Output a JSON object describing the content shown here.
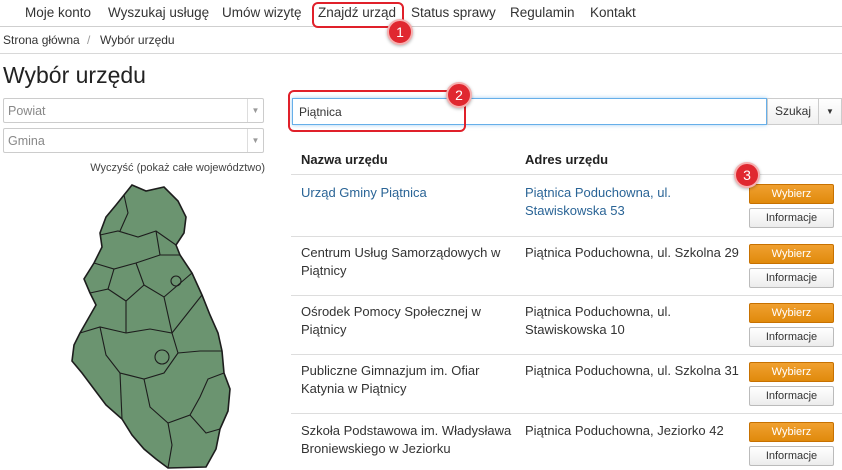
{
  "nav": {
    "items": [
      {
        "label": "Moje konto"
      },
      {
        "label": "Wyszukaj usługę"
      },
      {
        "label": "Umów wizytę"
      },
      {
        "label": "Znajdź urząd"
      },
      {
        "label": "Status sprawy"
      },
      {
        "label": "Regulamin"
      },
      {
        "label": "Kontakt"
      }
    ]
  },
  "breadcrumb": {
    "home": "Strona główna",
    "sep": "/",
    "current": "Wybór urzędu"
  },
  "page": {
    "title": "Wybór urzędu"
  },
  "filters": {
    "powiat": "Powiat",
    "gmina": "Gmina",
    "clear": "Wyczyść (pokaż całe województwo)"
  },
  "search": {
    "value": "Piątnica",
    "button": "Szukaj"
  },
  "table": {
    "headers": {
      "name": "Nazwa urzędu",
      "address": "Adres urzędu"
    },
    "select_label": "Wybierz",
    "info_label": "Informacje",
    "rows": [
      {
        "name": "Urząd Gminy Piątnica",
        "address": "Piątnica Poduchowna, ul. Stawiskowska 53"
      },
      {
        "name": "Centrum Usług Samorządowych w Piątnicy",
        "address": "Piątnica Poduchowna, ul. Szkolna 29"
      },
      {
        "name": "Ośrodek Pomocy Społecznej w Piątnicy",
        "address": "Piątnica Poduchowna, ul. Stawiskowska 10"
      },
      {
        "name": "Publiczne Gimnazjum im. Ofiar Katynia w Piątnicy",
        "address": "Piątnica Poduchowna, ul. Szkolna 31"
      },
      {
        "name": "Szkoła Podstawowa im. Władysława Broniewskiego w Jeziorku",
        "address": "Piątnica Poduchowna, Jeziorko 42"
      }
    ]
  },
  "annotations": {
    "one": "1",
    "two": "2",
    "three": "3"
  },
  "colors": {
    "accent": "#e08a0c",
    "link": "#2a6496",
    "map": "#6b9470",
    "marker": "#e02830"
  }
}
